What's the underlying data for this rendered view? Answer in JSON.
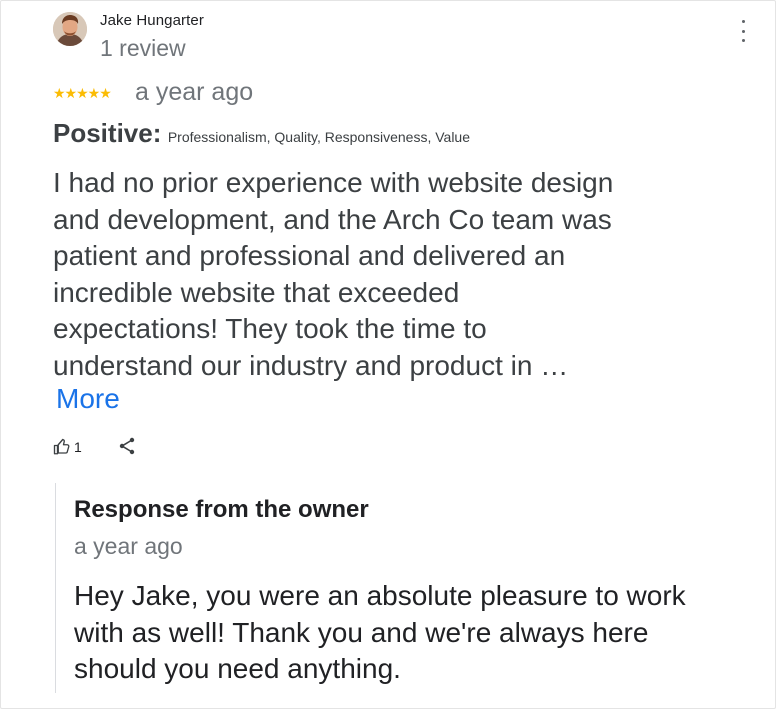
{
  "reviewer": {
    "name": "Jake Hungarter",
    "review_count": "1 review"
  },
  "rating": {
    "value": 5,
    "max": 5,
    "stars": "★★★★★",
    "time": "a year ago"
  },
  "attributes": {
    "label": "Positive:",
    "values": "Professionalism, Quality, Responsiveness, Value"
  },
  "review": {
    "lines": [
      "I had no prior experience with website design",
      "and development, and the Arch Co team was",
      "patient and professional and delivered an",
      "incredible website that exceeded",
      "expectations!  They took the time to",
      "understand our industry and product in …"
    ],
    "more_label": "More"
  },
  "actions": {
    "like_count": "1"
  },
  "owner_response": {
    "title": "Response from the owner",
    "time": "a year ago",
    "lines": [
      "Hey Jake, you were an absolute pleasure to work",
      "with as well! Thank you and we're always here",
      "should you need anything."
    ]
  },
  "colors": {
    "star": "#fbbc04",
    "link": "#1a73e8",
    "secondary_text": "#70757a",
    "primary_text": "#3c4043"
  },
  "icons": {
    "menu": "more-vert-icon",
    "like": "thumb-up-icon",
    "share": "share-icon"
  }
}
